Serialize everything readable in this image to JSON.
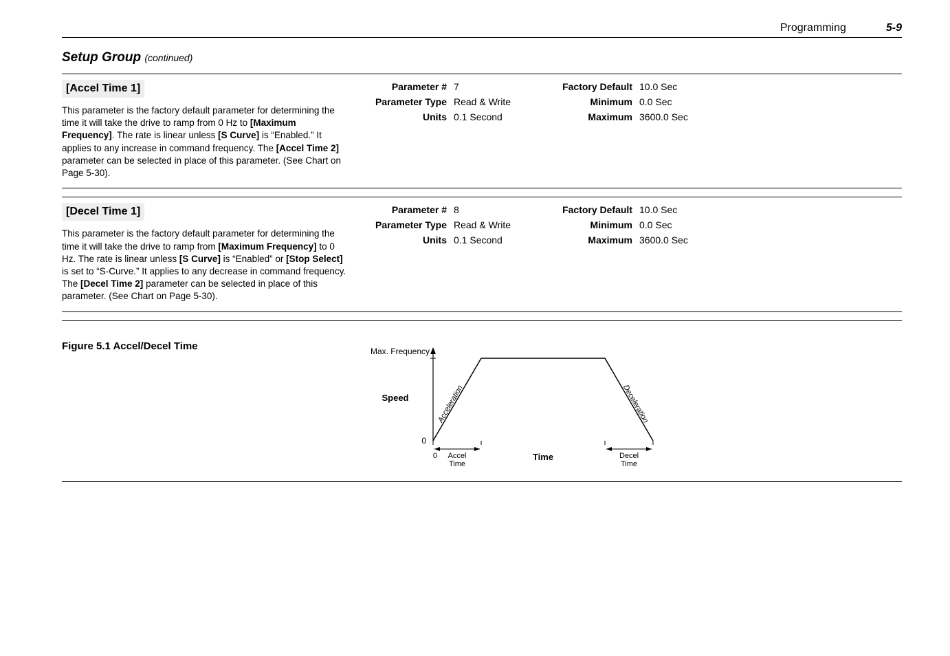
{
  "header": {
    "section": "Programming",
    "page": "5-9"
  },
  "group": {
    "title": "Setup Group",
    "continued": "(continued)"
  },
  "param1": {
    "name": "[Accel Time 1]",
    "desc_html": "This parameter is the factory default parameter for determining the time it will take the drive to ramp from 0 Hz to <b>[Maximum Frequency]</b>.   The rate is linear unless <b>[S Curve]</b> is “Enabled.”  It applies to any increase in command frequency. The <b>[Accel Time 2]</b> parameter can be selected in place of this parameter.  (See Chart on Page 5-30).",
    "kv": {
      "param_num_label": "Parameter #",
      "param_num": "7",
      "fact_def_label": "Factory Default",
      "fact_def": "10.0 Sec",
      "ptype_label": "Parameter Type",
      "ptype": "Read & Write",
      "min_label": "Minimum",
      "min": "0.0 Sec",
      "units_label": "Units",
      "units": "0.1 Second",
      "max_label": "Maximum",
      "max": "3600.0 Sec"
    }
  },
  "param2": {
    "name": "[Decel Time 1]",
    "desc_html": "This parameter is the factory default parameter for determining the time it will take the drive to ramp from <b>[Maximum Frequency]</b> to 0 Hz.  The rate is linear unless <b>[S Curve]</b> is “Enabled” or <b>[Stop Select]</b> is set to “S-Curve.”  It applies to any decrease in command frequency.  The <b>[Decel Time 2]</b> parameter can be selected in place of this parameter.  (See Chart on Page 5-30).",
    "kv": {
      "param_num_label": "Parameter #",
      "param_num": "8",
      "fact_def_label": "Factory Default",
      "fact_def": "10.0 Sec",
      "ptype_label": "Parameter Type",
      "ptype": "Read & Write",
      "min_label": "Minimum",
      "min": "0.0 Sec",
      "units_label": "Units",
      "units": "0.1 Second",
      "max_label": "Maximum",
      "max": "3600.0 Sec"
    }
  },
  "figure": {
    "caption": "Figure 5.1  Accel/Decel Time",
    "labels": {
      "max_freq": "Max. Frequency",
      "speed": "Speed",
      "zero": "0",
      "zero_x": "0",
      "accel_label": "Accel\nTime",
      "decel_label": "Decel\nTime",
      "time": "Time",
      "acceleration": "Acceleration",
      "deceleration": "Deceleration"
    }
  },
  "chart_data": {
    "type": "line",
    "title": "Accel/Decel Time",
    "xlabel": "Time",
    "ylabel": "Speed",
    "ylim": [
      0,
      1
    ],
    "series": [
      {
        "name": "Speed profile",
        "x": [
          0,
          1,
          4,
          5
        ],
        "y": [
          0,
          1,
          1,
          0
        ]
      }
    ],
    "annotations": [
      "Acceleration (rising slope)",
      "Deceleration (falling slope)",
      "Max. Frequency (top level)",
      "Accel Time (0 to 1 on x)",
      "Decel Time (4 to 5 on x)"
    ]
  }
}
